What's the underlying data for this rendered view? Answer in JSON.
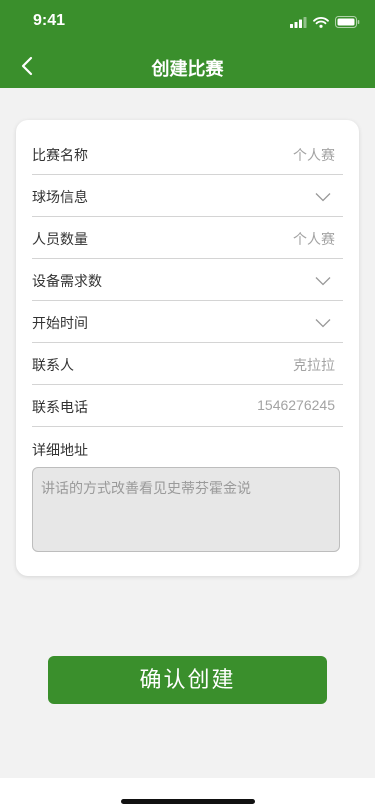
{
  "status_bar": {
    "time": "9:41"
  },
  "nav": {
    "title": "创建比赛",
    "back_icon": "chevron-left-icon"
  },
  "form": {
    "fields": [
      {
        "label": "比赛名称",
        "value": "个人赛",
        "type": "text"
      },
      {
        "label": "球场信息",
        "value": "",
        "type": "select"
      },
      {
        "label": "人员数量",
        "value": "个人赛",
        "type": "text"
      },
      {
        "label": "设备需求数",
        "value": "",
        "type": "select"
      },
      {
        "label": "开始时间",
        "value": "",
        "type": "select"
      },
      {
        "label": "联系人",
        "value": "克拉拉",
        "type": "text"
      },
      {
        "label": "联系电话",
        "value": "1546276245",
        "type": "text"
      }
    ],
    "address_label": "详细地址",
    "address_value": "讲话的方式改善看见史蒂芬霍金说"
  },
  "confirm_label": "确认创建",
  "colors": {
    "brand": "#3a8f2c",
    "background": "#f2f2f2",
    "placeholder": "#a3a3a3"
  }
}
